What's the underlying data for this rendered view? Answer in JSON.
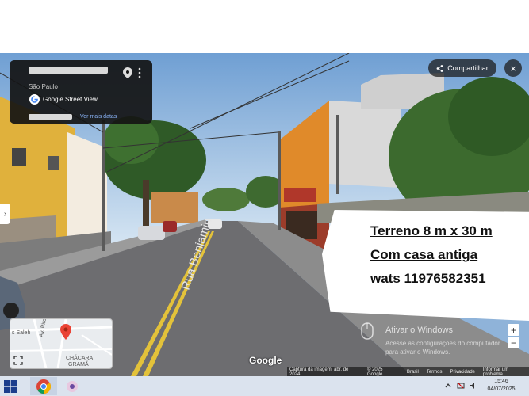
{
  "info_card": {
    "city": "São Paulo",
    "service": "Google Street View",
    "more_dates": "Ver mais datas"
  },
  "toolbar": {
    "share_label": "Compartilhar",
    "close_glyph": "×"
  },
  "overlay": {
    "line1": "Terreno  8 m x 30 m",
    "line2": "Com casa antiga",
    "line3": "wats 11976582351"
  },
  "street_sign": "Rua Benjamin",
  "minimap": {
    "label_saleh": "s Saleh",
    "label_street": "Av. Pirotti",
    "label_area": "CHÁCARA",
    "label_area2": "GRAMÃ"
  },
  "watermark": {
    "google": "Google",
    "activate_title": "Ativar o Windows",
    "activate_sub": "Acesse as configurações do computador para ativar o Windows."
  },
  "attribution": {
    "capture": "Captura da imagem: abr. de 2024",
    "copyright": "© 2025 Google",
    "brazil": "Brasil",
    "terms": "Termos",
    "privacy": "Privacidade",
    "report": "Informar um problema"
  },
  "zoom": {
    "in": "+",
    "out": "−"
  },
  "taskbar": {
    "time": "15:46",
    "date": "04/07/2025"
  },
  "colors": {
    "sky": "#8fb3d9",
    "orange_wall": "#e08a2a",
    "road": "#6d6d70"
  }
}
